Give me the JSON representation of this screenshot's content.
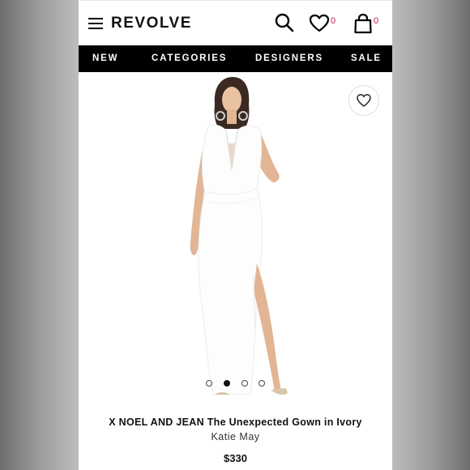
{
  "header": {
    "logo": "REVOLVE",
    "wishlist_count": "0",
    "bag_count": "0"
  },
  "nav": {
    "items": [
      "NEW",
      "CATEGORIES",
      "DESIGNERS",
      "SALE"
    ]
  },
  "product": {
    "title": "X NOEL AND JEAN The Unexpected Gown in Ivory",
    "brand": "Katie May",
    "price": "$330",
    "carousel": {
      "total_images": 4,
      "active_index": 1
    }
  },
  "icons": {
    "menu": "hamburger-icon",
    "search": "search-icon",
    "wishlist": "heart-icon",
    "bag": "shopping-bag-icon",
    "favorite": "heart-outline-icon"
  },
  "colors": {
    "accent": "#c2185b",
    "nav_background": "#000000"
  }
}
